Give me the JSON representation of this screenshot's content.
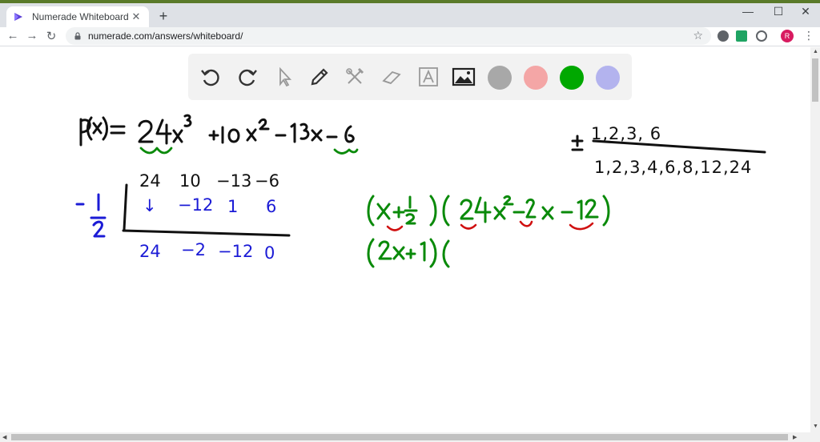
{
  "browser": {
    "tab_title": "Numerade Whiteboard",
    "tab_close": "✕",
    "new_tab": "+",
    "minimize": "—",
    "maximize": "☐",
    "close": "✕",
    "back": "←",
    "forward": "→",
    "reload": "↻",
    "url": "numerade.com/answers/whiteboard/",
    "bookmark": "☆",
    "profile_initial": "R",
    "menu": "⋮"
  },
  "whiteboard_toolbar": {
    "tools": [
      "undo-icon",
      "redo-icon",
      "pointer-icon",
      "pen-icon",
      "tools-icon",
      "eraser-icon",
      "text-icon",
      "image-icon"
    ],
    "colors": [
      "#a8a8a8",
      "#f4a6a6",
      "#00a800",
      "#b3b3ee"
    ],
    "selected_color": "#00a800"
  },
  "handwriting": {
    "polynomial": "P(x)= 24x³ +10x² −13x −6",
    "rational_roots": {
      "numerators": "1,2,3, 6",
      "denominators": "1,2,3,4,6,8,12,24"
    },
    "synthetic_division": {
      "divisor": "−1/2",
      "coefficients": [
        "24",
        "10",
        "−13",
        "−6"
      ],
      "products": [
        "↓",
        "−12",
        "1",
        "6"
      ],
      "results": [
        "24",
        "−2",
        "−12",
        "0"
      ]
    },
    "factor_line_1": "(x + ½)(24x² − 2x − 12)",
    "factor_line_2": "(2x+1)("
  }
}
